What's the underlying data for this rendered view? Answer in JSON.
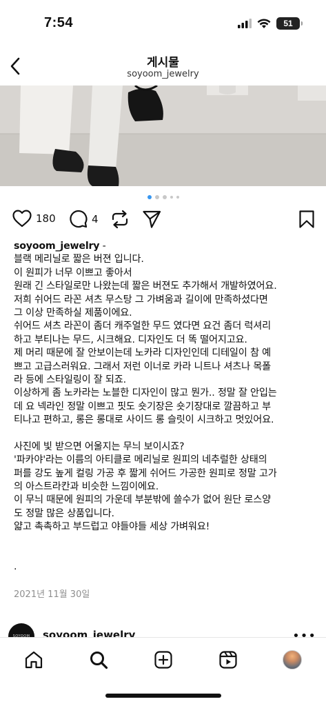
{
  "status_bar": {
    "time": "7:54",
    "battery": "51"
  },
  "header": {
    "title": "게시물",
    "username": "soyoom_jewelry"
  },
  "carousel": {
    "total_dots": 5,
    "active_index": 0
  },
  "actions": {
    "likes": "180",
    "comments": "4"
  },
  "caption": {
    "username": "soyoom_jewelry",
    "lines": [
      " -",
      "블랙 메리닐로 짧은 버젼 입니다.",
      "이 원피가 너무 이쁘고 좋아서",
      "원래 긴 스타일로만 나왔는데 짧은 버젼도 추가해서 개발하였어요.",
      "저희 쉬어드 라꼰 셔츠 무스탕 그 가벼움과 길이에 만족하셨다면",
      "그 이상 만족하실 제품이에요.",
      "쉬어드 셔츠 라꼰이 좀더 캐주얼한 무드 였다면 요건 좀더 럭셔리",
      "하고 부티나는 무드, 시크해요. 디자인도 더 똑 떨어지고요.",
      "제 머리 때문에 잘 안보이는데 노카라 디자인인데 디테일이 참 예",
      "쁘고 고급스러워요. 그래서 저런 이너로 카라 니트나 셔츠나 목폴",
      "라 등에 스타일링이 잘 되죠.",
      "이상하게 좀 노카라는 노블한 디자인이 많고 뭔가.. 정말 잘 안입는",
      "데 요 넥라인 정말 이쁘고 핏도 숏기장은 숏기장대로 깔끔하고 부",
      "티나고 편하고, 롱은 롱대로 사이드 롱 슬릿이 시크하고 멋있어요.",
      "",
      " 사진에 빛 받으면 어울지는 무늬 보이시죠?",
      "'파카야'라는 이름의 아티클로 메리닐로 원피의 네추럴한 상태의",
      "퍼를 강도 높게 컬링 가공 후 짧게 쉬어드 가공한 원피로 정말 고가",
      "의 아스트라칸과 비슷한 느낌이에요.",
      "이 무늬 때문에 원피의 가운데 부분밖에 쓸수가 없어 원단 로스양",
      "도 정말 많은 상품입니다.",
      "얇고 촉촉하고 부드럽고 야들야들 세상 가벼워요!",
      "",
      "",
      "."
    ],
    "date": "2021년 11월 30일"
  },
  "next_post": {
    "avatar_text": "SOYOOM",
    "username": "soyoom_jewelry",
    "more": "•••"
  },
  "icons": {
    "back": "chevron-left-icon",
    "like": "heart-icon",
    "comment": "comment-icon",
    "share": "repost-icon",
    "send": "send-icon",
    "save": "bookmark-icon"
  }
}
